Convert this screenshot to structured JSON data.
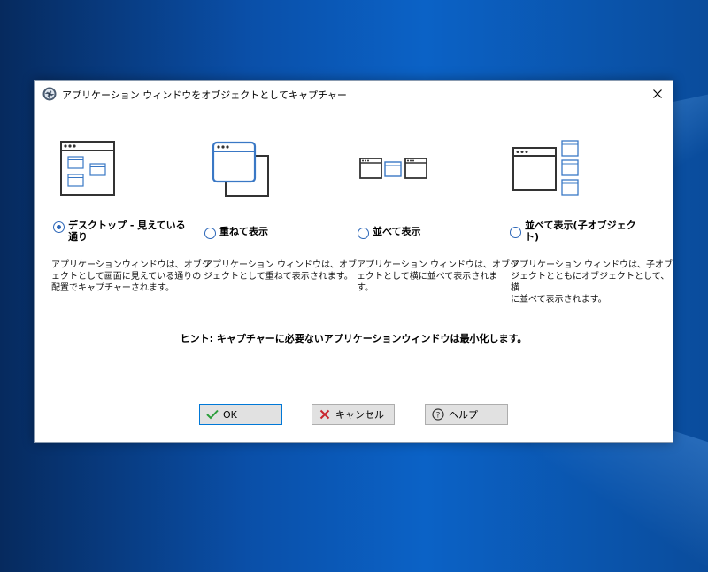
{
  "dialog": {
    "title": "アプリケーション ウィンドウをオブジェクトとしてキャプチャー",
    "hint": "ヒント: キャプチャーに必要ないアプリケーションウィンドウは最小化します。"
  },
  "options": [
    {
      "label_line1": "デスクトップ - 見えている",
      "label_line2": "通り",
      "selected": true,
      "desc_line1": "アプリケーションウィンドウは、オブジ",
      "desc_line2": "ェクトとして画面に見えている通りの",
      "desc_line3": "配置でキャプチャーされます。"
    },
    {
      "label_line1": "重ねて表示",
      "selected": false,
      "desc_line1": "アプリケーション ウィンドウは、オブ",
      "desc_line2": "ジェクトとして重ねて表示されます。"
    },
    {
      "label_line1": "並べて表示",
      "selected": false,
      "desc_line1": "アプリケーション ウィンドウは、オブジ",
      "desc_line2": "ェクトとして横に並べて表示されま",
      "desc_line3": "す。"
    },
    {
      "label_line1": "並べて表示(子オブジェク",
      "label_line2": "ト)",
      "selected": false,
      "desc_line1": "アプリケーション ウィンドウは、子オブ",
      "desc_line2": "ジェクトとともにオブジェクトとして、横",
      "desc_line3": "に並べて表示されます。"
    }
  ],
  "buttons": {
    "ok": "OK",
    "cancel": "キャンセル",
    "help": "ヘルプ"
  },
  "icons": {
    "app": "camera-aperture-icon",
    "close": "close-icon",
    "ok": "checkmark-icon",
    "cancel": "x-icon",
    "help": "question-circle-icon"
  },
  "colors": {
    "accent": "#2b66b8",
    "ok_check": "#2a9d3a",
    "cancel_x": "#c8242e",
    "illustration_dark": "#333333",
    "illustration_blue": "#3a78c5"
  }
}
